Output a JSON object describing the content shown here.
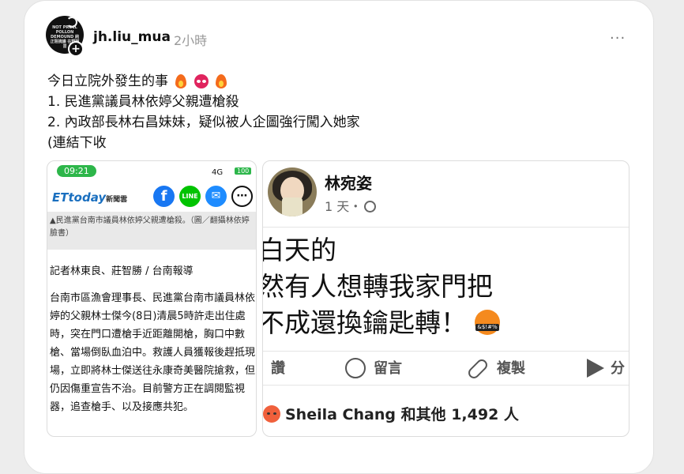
{
  "post": {
    "username": "jh.liu_mua",
    "time_ago": "2小時",
    "more": "···",
    "avatar_text": "NOT PROLL POLLON DEMOUND 純正阻撓議 在野陋習",
    "follow_symbol": "+",
    "lines": [
      "今日立院外發生的事",
      "1. 民進黨議員林依婷父親遭槍殺",
      "2. 內政部長林右昌妹妹，疑似被人企圖強行闖入她家",
      "(連結下收"
    ]
  },
  "news_screenshot": {
    "time": "09:21",
    "signal": "4G",
    "battery": "100",
    "logo": "ETtoday",
    "logo_sub": "新聞雲",
    "share_icons": [
      "facebook-icon",
      "line-icon",
      "messenger-icon",
      "more-share-icon"
    ],
    "fb_glyph": "f",
    "line_glyph": "LINE",
    "msg_glyph": "✉",
    "more_glyph": "⋯",
    "caption": "▲民進黨台南市議員林依婷父親遭槍殺。（圖／翻攝林依婷臉書）",
    "reporter": "記者林東良、莊智勝 / 台南報導",
    "body": "台南市區漁會理事長、民進黨台南市議員林依婷的父親林士傑今(8日)清晨5時許走出住處時，突在門口遭槍手近距離開槍，胸口中數槍、當場倒臥血泊中。救護人員獲報後趕抵現場，立即將林士傑送往永康奇美醫院搶救，但仍因傷重宣告不治。目前警方正在調閱監視器，追查槍手、以及接應共犯。"
  },
  "fb_screenshot": {
    "name": "林宛姿",
    "time": "1 天・",
    "body_lines": [
      "白天的",
      "然有人想轉我家門把",
      "不成還換鑰匙轉！"
    ],
    "actions": {
      "like": "讚",
      "comment": "留言",
      "copy": "複製",
      "share": "分"
    },
    "reactions": "Sheila Chang 和其他 1,492 人"
  }
}
